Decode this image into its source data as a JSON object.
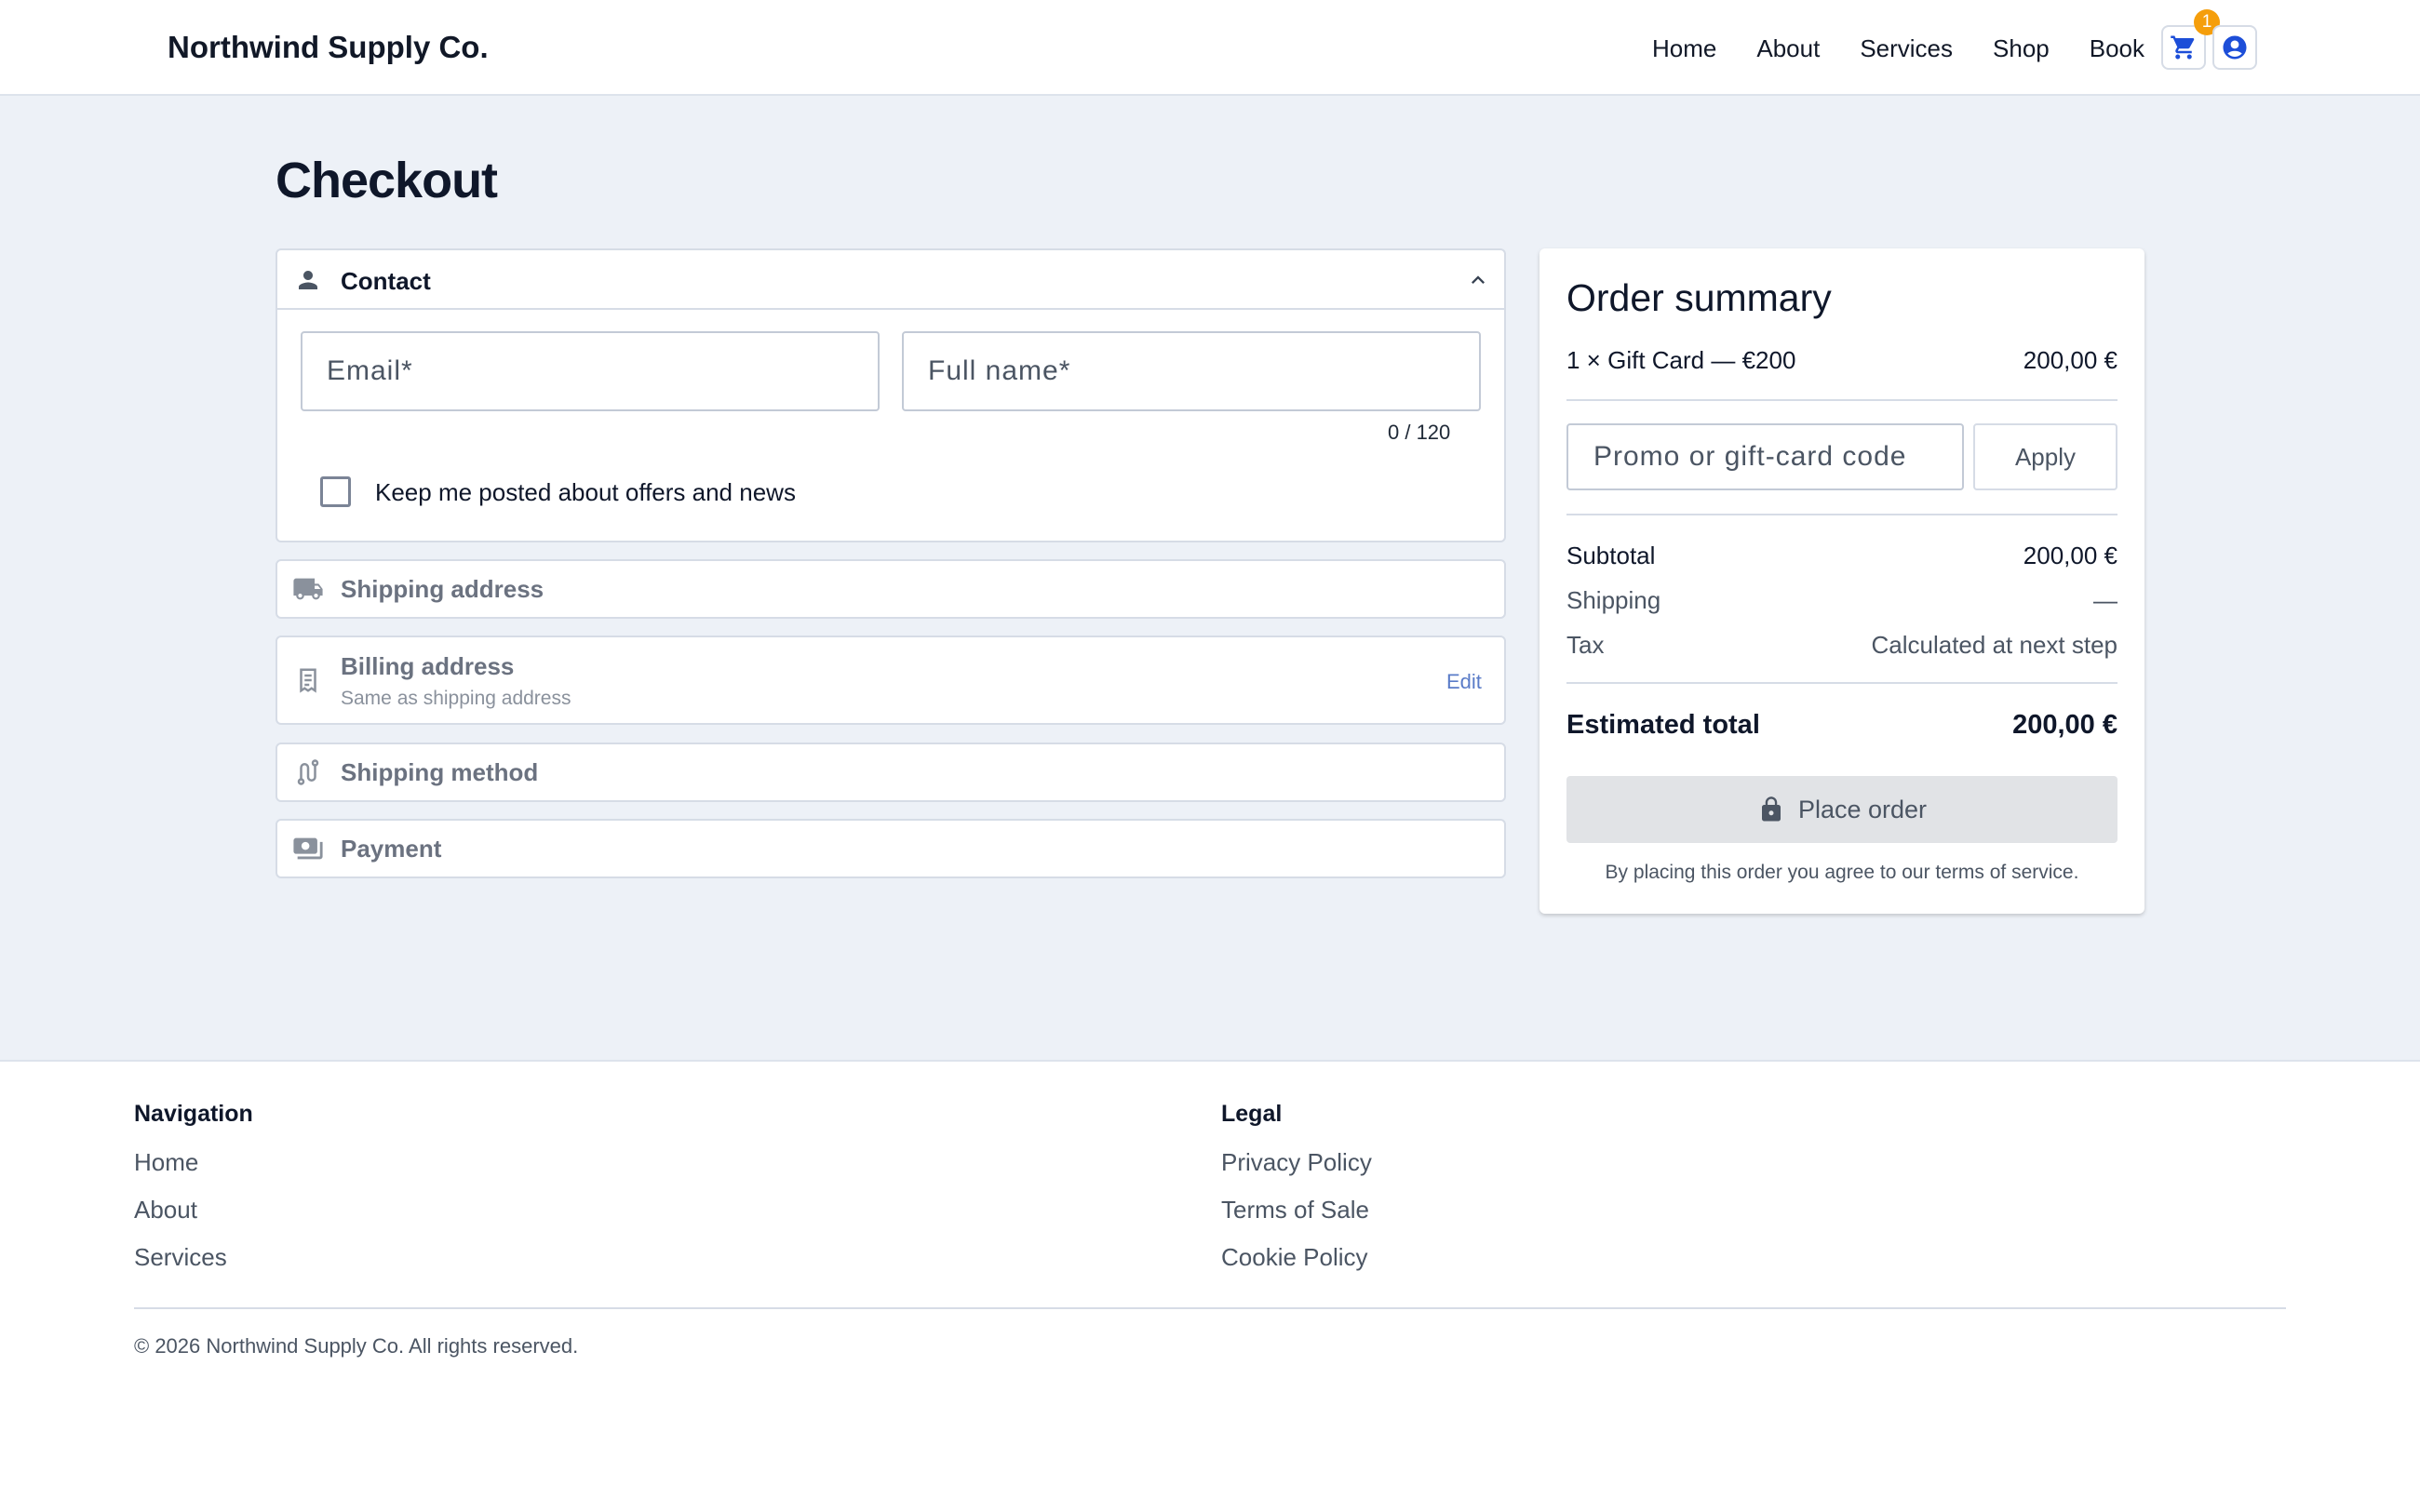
{
  "header": {
    "brand": "Northwind Supply Co.",
    "nav": [
      "Home",
      "About",
      "Services",
      "Shop",
      "Book"
    ],
    "cart_count": "1"
  },
  "page": {
    "title": "Checkout"
  },
  "contact": {
    "title": "Contact",
    "email_placeholder": "Email*",
    "name_placeholder": "Full name*",
    "char_count": "0 / 120",
    "newsletter_label": "Keep me posted about offers and news"
  },
  "sections": {
    "shipping_address": "Shipping address",
    "billing_address": "Billing address",
    "billing_sub": "Same as shipping address",
    "billing_edit": "Edit",
    "shipping_method": "Shipping method",
    "payment": "Payment"
  },
  "summary": {
    "title": "Order summary",
    "item_label": "1 × Gift Card — €200",
    "item_price": "200,00 €",
    "promo_placeholder": "Promo or gift-card code",
    "apply_label": "Apply",
    "subtotal_label": "Subtotal",
    "subtotal_value": "200,00 €",
    "shipping_label": "Shipping",
    "shipping_value": "—",
    "tax_label": "Tax",
    "tax_value": "Calculated at next step",
    "total_label": "Estimated total",
    "total_value": "200,00 €",
    "place_order_label": "Place order",
    "terms": "By placing this order you agree to our terms of service."
  },
  "footer": {
    "nav_heading": "Navigation",
    "nav_links": [
      "Home",
      "About",
      "Services"
    ],
    "legal_heading": "Legal",
    "legal_links": [
      "Privacy Policy",
      "Terms of Sale",
      "Cookie Policy"
    ],
    "copyright": "© 2026 Northwind Supply Co. All rights reserved."
  },
  "colors": {
    "accent": "#1d4ed8",
    "badge": "#f59e0b",
    "page_bg": "#edf1f7",
    "edit_link": "#5a7cc8"
  },
  "icons": {
    "cart": "cart-icon",
    "account": "account-icon",
    "contact": "person-icon",
    "collapse": "chevron-up-icon",
    "shipping_address": "truck-icon",
    "billing_address": "receipt-icon",
    "shipping_method": "route-icon",
    "payment": "payments-icon",
    "place_order": "lock-icon"
  }
}
